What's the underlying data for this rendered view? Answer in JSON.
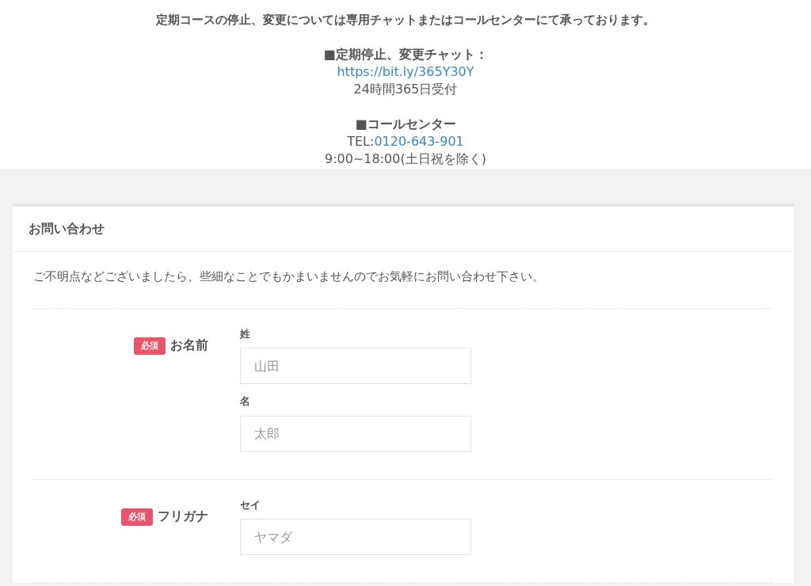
{
  "notice": {
    "headline": "定期コースの停止、変更については専用チャットまたはコールセンターにて承っております。",
    "contacts": [
      {
        "heading": "■定期停止、変更チャット：",
        "link": "https://bit.ly/365Y30Y",
        "hours": "24時間365日受付"
      },
      {
        "heading": "■コールセンター",
        "prefix": "TEL:",
        "link": "0120-643-901",
        "hours": "9:00~18:00(土日祝を除く)"
      }
    ]
  },
  "form": {
    "title": "お問い合わせ",
    "intro": "ご不明点などございましたら、些細なことでもかまいませんのでお気軽にお問い合わせ下さい。",
    "rows": [
      {
        "label": "お名前",
        "required": true,
        "badge": "必須",
        "fields": [
          {
            "label": "姓",
            "placeholder": "山田"
          },
          {
            "label": "名",
            "placeholder": "太郎"
          }
        ]
      },
      {
        "label": "フリガナ",
        "required": true,
        "badge": "必須",
        "fields": [
          {
            "label": "セイ",
            "placeholder": "ヤマダ"
          }
        ]
      }
    ]
  }
}
